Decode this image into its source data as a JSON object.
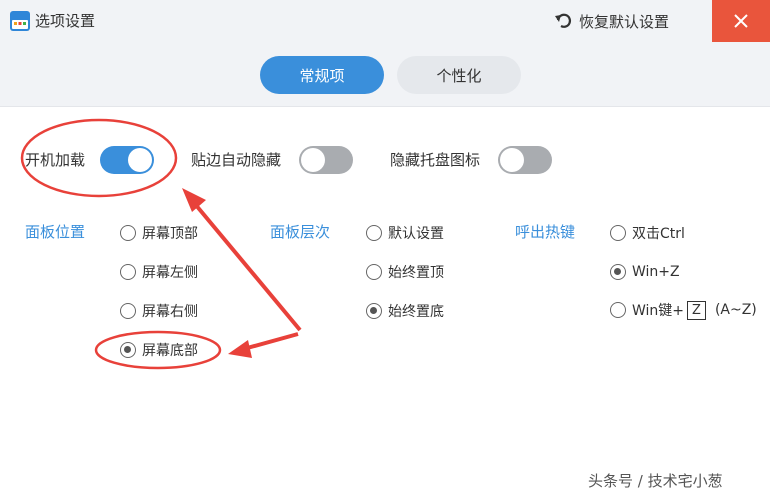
{
  "window": {
    "title": "选项设置",
    "reset_label": "恢复默认设置",
    "close_symbol": "✕"
  },
  "tabs": [
    {
      "label": "常规项",
      "active": true
    },
    {
      "label": "个性化",
      "active": false
    }
  ],
  "toggles": [
    {
      "label": "开机加载",
      "on": true
    },
    {
      "label": "贴边自动隐藏",
      "on": false
    },
    {
      "label": "隐藏托盘图标",
      "on": false
    }
  ],
  "panel_position": {
    "label": "面板位置",
    "options": [
      {
        "label": "屏幕顶部",
        "checked": false
      },
      {
        "label": "屏幕左侧",
        "checked": false
      },
      {
        "label": "屏幕右侧",
        "checked": false
      },
      {
        "label": "屏幕底部",
        "checked": true
      }
    ]
  },
  "panel_layer": {
    "label": "面板层次",
    "options": [
      {
        "label": "默认设置",
        "checked": false
      },
      {
        "label": "始终置顶",
        "checked": false
      },
      {
        "label": "始终置底",
        "checked": true
      }
    ]
  },
  "hotkey": {
    "label": "呼出热键",
    "options": [
      {
        "label": "双击Ctrl",
        "checked": false
      },
      {
        "label": "Win+Z",
        "checked": true
      },
      {
        "label_prefix": "Win键+",
        "key": "Z",
        "label_suffix": "(A~Z)",
        "checked": false
      }
    ]
  },
  "watermark": "头条号 / 技术宅小葱",
  "colors": {
    "accent": "#3a8fdb",
    "close_bg": "#e9553c",
    "annotation": "#e8413a"
  }
}
